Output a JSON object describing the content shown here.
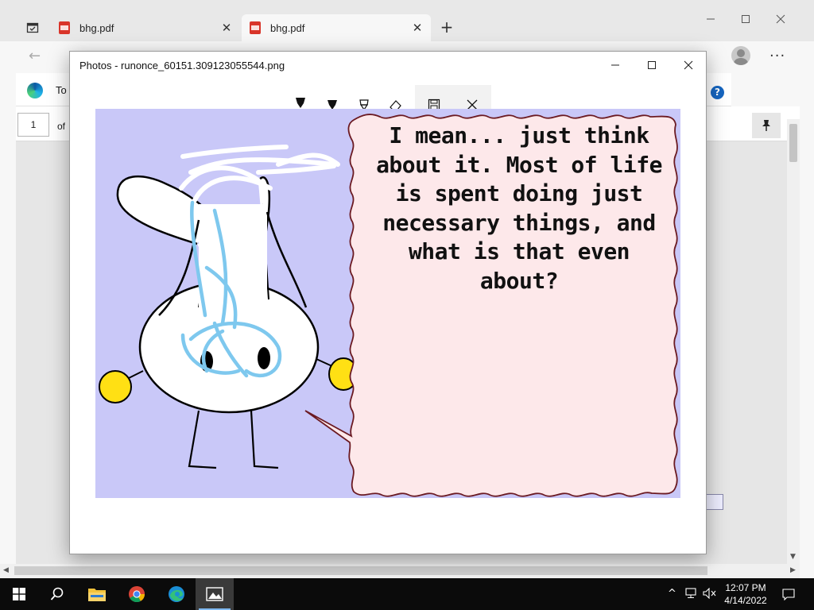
{
  "browser": {
    "tabs": [
      {
        "label": "bhg.pdf"
      },
      {
        "label": "bhg.pdf"
      }
    ],
    "infobar_text": "To",
    "page_number": "1",
    "page_of": "of"
  },
  "photos": {
    "title": "Photos - runonce_60151.309123055544.png",
    "toolbar": {
      "tools": [
        "ballpoint-pen",
        "pencil",
        "calligraphy-pen",
        "eraser"
      ],
      "active_tool": "ballpoint-pen"
    }
  },
  "comic": {
    "speech_lines": [
      "I mean... just think",
      "about it. Most of life",
      "is spent doing just",
      "necessary things, and",
      "what is that even",
      "about?"
    ],
    "colors": {
      "background": "#c9c8f8",
      "bubble": "#fde8ea",
      "bubble_outline": "#6b1a22",
      "ink_scribble": "#7ec8ee",
      "hands": "#ffe014"
    }
  },
  "taskbar": {
    "time": "12:07 PM",
    "date": "4/14/2022",
    "apps": [
      "start",
      "search",
      "file-explorer",
      "chrome",
      "edge",
      "photos"
    ],
    "active_app": "photos"
  }
}
